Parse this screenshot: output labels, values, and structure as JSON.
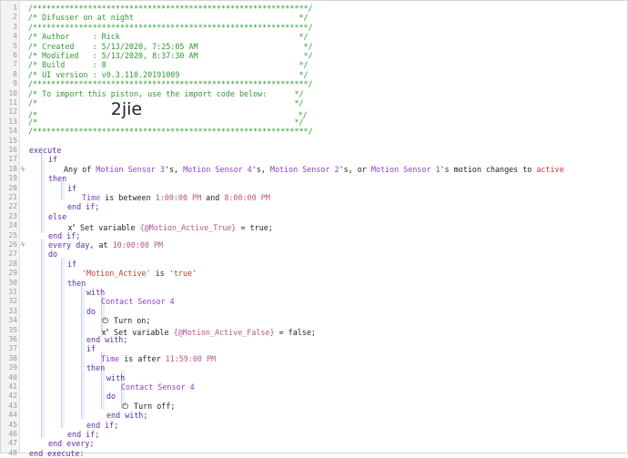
{
  "line_numbers": [
    "1",
    "2",
    "3",
    "4",
    "5",
    "6",
    "7",
    "8",
    "9",
    "10",
    "11",
    "12",
    "13",
    "14",
    "15",
    "16",
    "17",
    "18",
    "19",
    "20",
    "21",
    "22",
    "23",
    "24",
    "25",
    "26",
    "27",
    "28",
    "29",
    "30",
    "31",
    "32",
    "33",
    "34",
    "35",
    "36",
    "37",
    "38",
    "39",
    "40",
    "41",
    "42",
    "43",
    "44",
    "45",
    "46",
    "47",
    "48"
  ],
  "header": {
    "border": "/************************************************************/",
    "title": "/* Difusser on at night                                    */",
    "author": "/* Author     : Rick                                       */",
    "created": "/* Created    : 5/13/2020, 7:25:05 AM                       */",
    "modified": "/* Modified   : 5/13/2020, 8:37:30 AM                       */",
    "build": "/* Build      : 8                                          */",
    "ui_version": "/* UI version : v0.3.110.20191009                          */",
    "import_note": "/* To import this piston, use the import code below:      */",
    "blank_a": "/*                                                        */",
    "code_prefix": "/*                ",
    "import_code": "2jie",
    "code_suffix": "                                  */",
    "blank_b": "/*                                                        */"
  },
  "code": {
    "execute": "execute",
    "if": "if",
    "then": "then",
    "else": "else",
    "do": "do",
    "with": "with",
    "end_if": "end if;",
    "end_with": "end with;",
    "end_every": "end every;",
    "end_execute": "end execute;",
    "any_of": "Any of ",
    "sensor3": "Motion Sensor 3",
    "sensor4": "Motion Sensor 4",
    "sensor2": "Motion Sensor 2",
    "sensor1": "Motion Sensor 1",
    "apos_s_comma": "'s, ",
    "apos_s_comma_or": "'s, or ",
    "motion_changes": "'s motion changes to ",
    "active": "active",
    "time": "Time",
    "is_between": " is between ",
    "t1": "1:00:00 PM",
    "and": " and ",
    "t2": "8:00:00 PM",
    "set_variable": " Set variable ",
    "var_true": "{@Motion_Active_True}",
    "eq_true": " = true;",
    "every_day": "every day",
    "at": ", at ",
    "t3": "10:00:00 PM",
    "motion_active_str": "'Motion_Active'",
    "is": " is ",
    "true_str": "'true'",
    "contact_sensor": "Contact Sensor 4",
    "turn_on": " Turn on;",
    "var_false": "{@Motion_Active_False}",
    "eq_false": " = false;",
    "is_after": " is after ",
    "t4": "11:59:00 PM",
    "turn_off": " Turn off;"
  },
  "icons": {
    "line18_marker": "lightning-icon",
    "line26_marker": "timer-icon",
    "variable": "variable-x-icon",
    "power": "power-icon"
  },
  "colors": {
    "comment": "#2f9a2f",
    "keyword": "#5a2aa5",
    "device": "#8a3fd0",
    "value": "#b8548c",
    "string": "#c0392b"
  }
}
